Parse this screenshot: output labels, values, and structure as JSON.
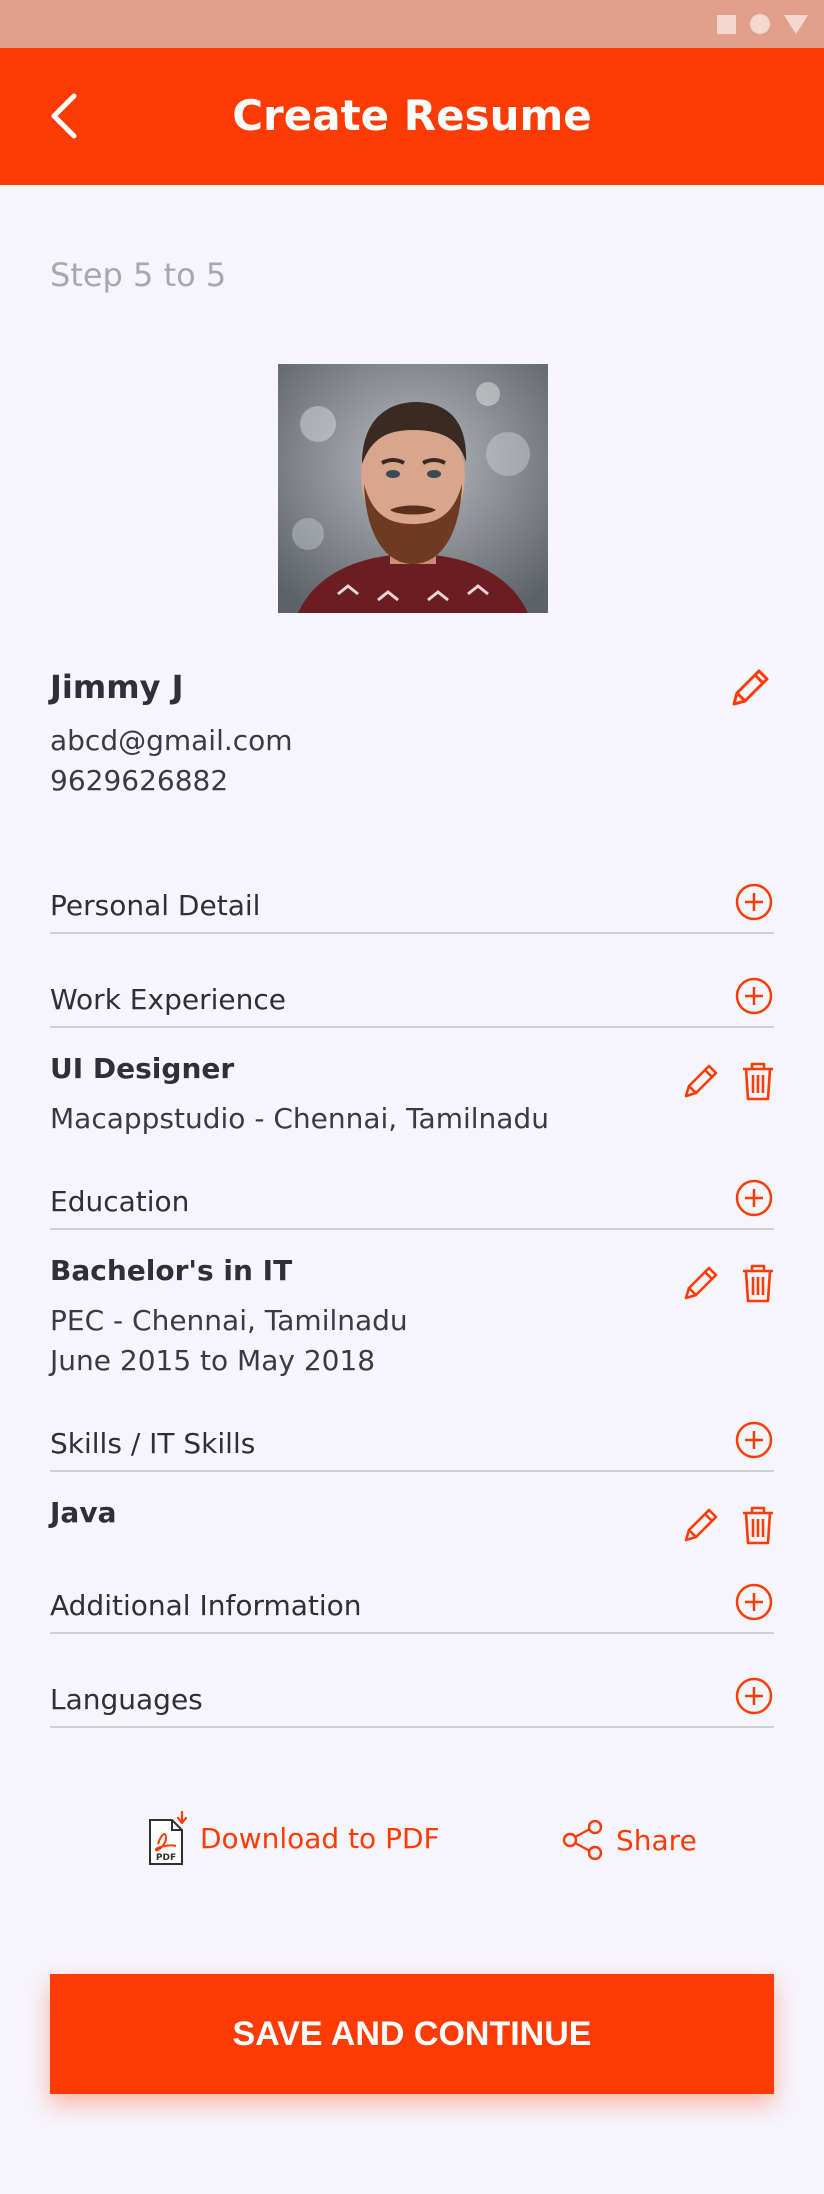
{
  "header": {
    "title": "Create Resume"
  },
  "step_text": "Step 5 to 5",
  "profile": {
    "name": "Jimmy J",
    "email": "abcd@gmail.com",
    "phone": "9629626882"
  },
  "sections": {
    "personal": "Personal Detail",
    "work": "Work Experience",
    "education": "Education",
    "skills": "Skills / IT Skills",
    "additional": "Additional Information",
    "languages": "Languages"
  },
  "work_entry": {
    "title": "UI Designer",
    "line1": "Macappstudio - Chennai, Tamilnadu"
  },
  "education_entry": {
    "title": "Bachelor's in IT",
    "line1": "PEC - Chennai, Tamilnadu",
    "line2": "June 2015 to May 2018"
  },
  "skill_entry": {
    "title": "Java"
  },
  "actions": {
    "download": "Download to PDF",
    "pdf_badge": "PDF",
    "share": "Share",
    "save": "SAVE AND CONTINUE"
  },
  "colors": {
    "accent": "#fe3b05",
    "status_bar": "#e0a08d",
    "background": "#f7f5fc"
  }
}
